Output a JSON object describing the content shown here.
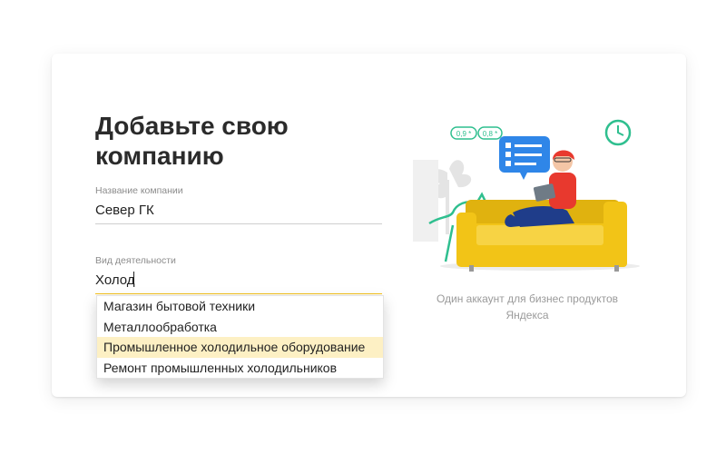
{
  "form": {
    "title": "Добавьте свою компанию",
    "company_name": {
      "label": "Название компании",
      "value": "Север ГК"
    },
    "activity": {
      "label": "Вид деятельности",
      "value": "Холод"
    },
    "suggestions": [
      {
        "label": "Магазин бытовой техники",
        "highlighted": false
      },
      {
        "label": "Металлообработка",
        "highlighted": false
      },
      {
        "label": "Промышленное холодильное оборудование",
        "highlighted": true
      },
      {
        "label": "Ремонт промышленных холодильников",
        "highlighted": false
      }
    ]
  },
  "illustration": {
    "rating_badges": [
      "0,9 *",
      "0,8 *"
    ],
    "caption": "Один аккаунт для бизнес продуктов Яндекса"
  },
  "colors": {
    "accent_yellow": "#f5c11b",
    "sofa_yellow": "#f2c417",
    "chat_blue": "#2f86e8",
    "mint_green": "#2fbf8f",
    "highlight_row": "#fdf0c4"
  }
}
